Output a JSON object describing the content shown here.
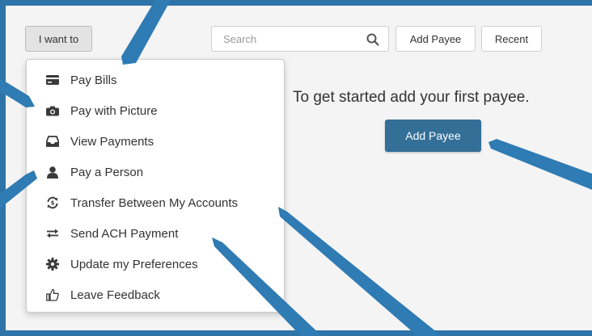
{
  "toolbar": {
    "i_want_to_label": "I want to",
    "search_placeholder": "Search",
    "add_payee_label": "Add Payee",
    "recent_label": "Recent"
  },
  "menu": {
    "items": [
      {
        "label": "Pay Bills",
        "icon": "credit-card-icon"
      },
      {
        "label": "Pay with Picture",
        "icon": "camera-icon"
      },
      {
        "label": "View Payments",
        "icon": "inbox-icon"
      },
      {
        "label": "Pay a Person",
        "icon": "person-icon"
      },
      {
        "label": "Transfer Between My Accounts",
        "icon": "transfer-icon"
      },
      {
        "label": "Send ACH Payment",
        "icon": "ach-arrows-icon"
      },
      {
        "label": "Update my Preferences",
        "icon": "gear-icon"
      },
      {
        "label": "Leave Feedback",
        "icon": "thumbs-up-icon"
      }
    ]
  },
  "main": {
    "message": "To get started add your first payee.",
    "add_payee_button": "Add Payee"
  },
  "colors": {
    "frame_accent": "#2f74a8",
    "primary_button": "#336f97",
    "callout_pointer": "#2f7bb3"
  }
}
